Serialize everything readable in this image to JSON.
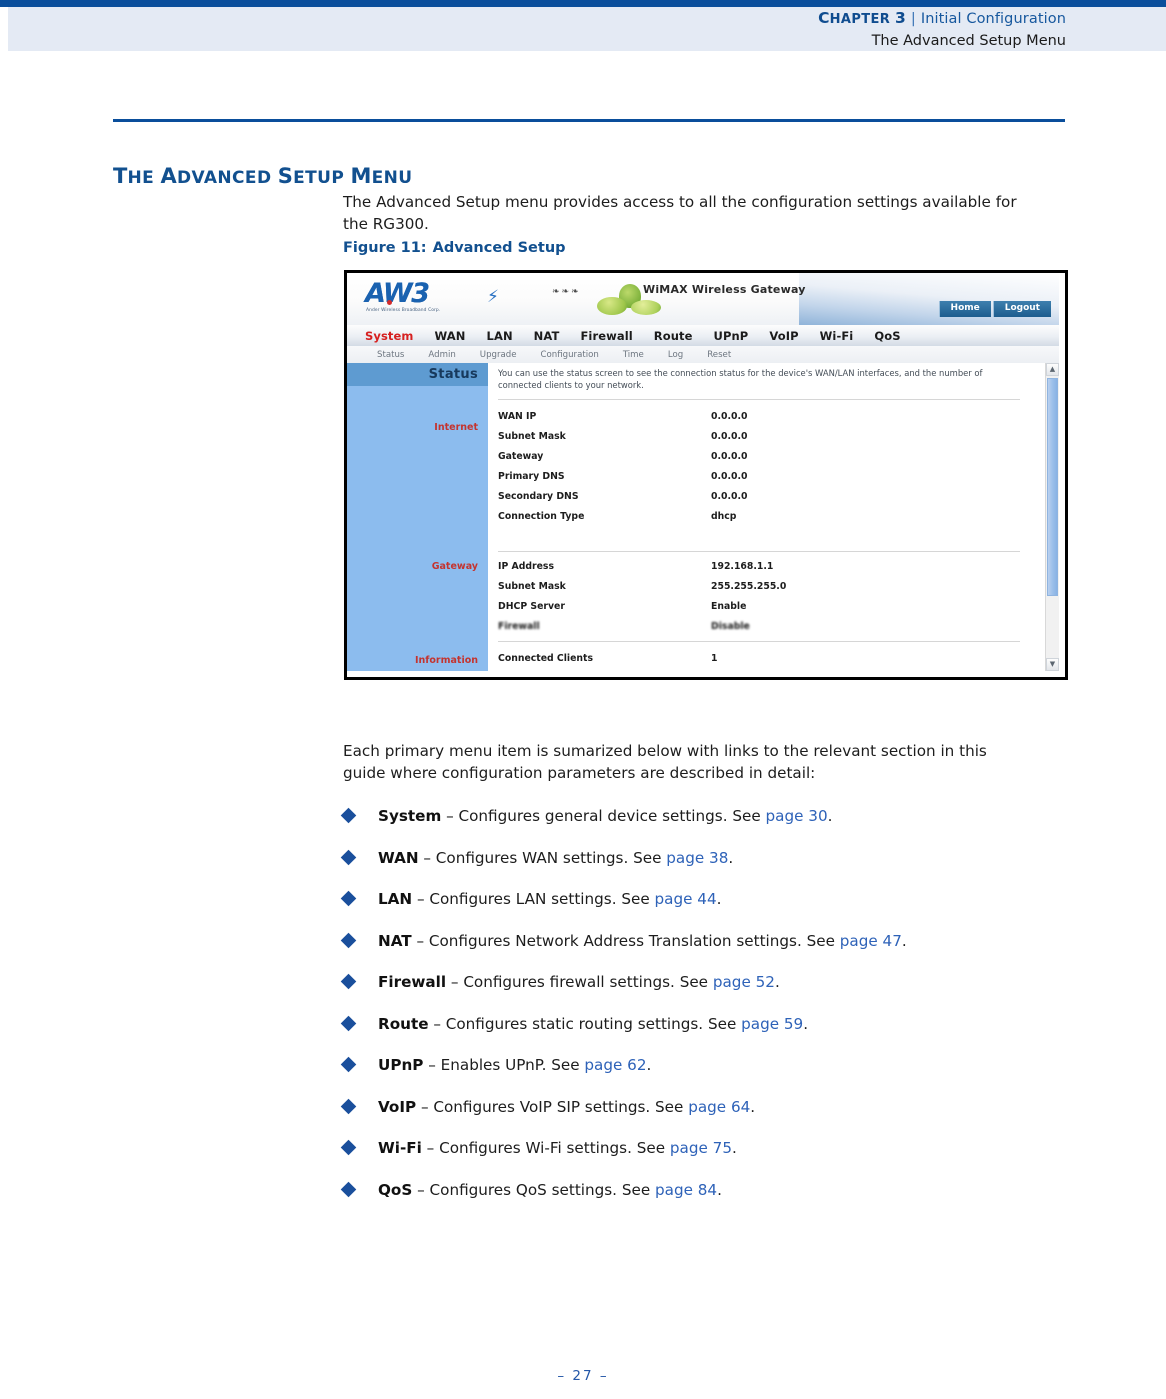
{
  "running_header": {
    "chapter_label_c": "C",
    "chapter_label_rest": "HAPTER",
    "chapter_number": "3",
    "separator": "|",
    "topic": "Initial Configuration",
    "subtitle": "The Advanced Setup Menu"
  },
  "section": {
    "title_parts": [
      {
        "text": "T",
        "size": "big"
      },
      {
        "text": "HE ",
        "size": "small"
      },
      {
        "text": "A",
        "size": "big"
      },
      {
        "text": "DVANCED ",
        "size": "small"
      },
      {
        "text": "S",
        "size": "big"
      },
      {
        "text": "ETUP ",
        "size": "small"
      },
      {
        "text": "M",
        "size": "big"
      },
      {
        "text": "ENU",
        "size": "small"
      }
    ],
    "intro": "The Advanced Setup menu provides access to all the configuration settings available for the RG300."
  },
  "figure": {
    "caption_label": "Figure 11:",
    "caption_title": "Advanced Setup"
  },
  "router_ui": {
    "logo_mark": "AW3",
    "logo_subtitle": "Ander Wireless Broadband Corp.",
    "product_title": "WiMAX Wireless Gateway",
    "actions": [
      "Home",
      "Logout"
    ],
    "nav": [
      {
        "label": "System",
        "active": true
      },
      {
        "label": "WAN",
        "active": false
      },
      {
        "label": "LAN",
        "active": false
      },
      {
        "label": "NAT",
        "active": false
      },
      {
        "label": "Firewall",
        "active": false
      },
      {
        "label": "Route",
        "active": false
      },
      {
        "label": "UPnP",
        "active": false
      },
      {
        "label": "VoIP",
        "active": false
      },
      {
        "label": "Wi-Fi",
        "active": false
      },
      {
        "label": "QoS",
        "active": false
      }
    ],
    "subnav": [
      "Status",
      "Admin",
      "Upgrade",
      "Configuration",
      "Time",
      "Log",
      "Reset"
    ],
    "sidebar": {
      "heading": "Status",
      "group_internet": "Internet",
      "group_gateway": "Gateway",
      "group_information": "Information"
    },
    "description": "You can use the status screen to see the connection status for the device's WAN/LAN interfaces, and the number of connected clients to your network.",
    "internet_rows": [
      {
        "key": "WAN IP",
        "value": "0.0.0.0"
      },
      {
        "key": "Subnet Mask",
        "value": "0.0.0.0"
      },
      {
        "key": "Gateway",
        "value": "0.0.0.0"
      },
      {
        "key": "Primary DNS",
        "value": "0.0.0.0"
      },
      {
        "key": "Secondary DNS",
        "value": "0.0.0.0"
      },
      {
        "key": "Connection Type",
        "value": "dhcp"
      }
    ],
    "gateway_rows": [
      {
        "key": "IP Address",
        "value": "192.168.1.1"
      },
      {
        "key": "Subnet Mask",
        "value": "255.255.255.0"
      },
      {
        "key": "DHCP Server",
        "value": "Enable"
      },
      {
        "key": "Firewall",
        "value": "Disable"
      }
    ],
    "information_rows": [
      {
        "key": "Connected Clients",
        "value": "1"
      }
    ],
    "scroll_up_icon": "scroll-up-arrow",
    "scroll_down_icon": "scroll-down-arrow"
  },
  "after_paragraph": "Each primary menu item is sumarized below with links to the relevant section in this guide where configuration parameters are described in detail:",
  "bullets": [
    {
      "term": "System",
      "dash": " – ",
      "text": "Configures general device settings. See ",
      "link": "page 30",
      "period": "."
    },
    {
      "term": "WAN",
      "dash": " – ",
      "text": "Configures WAN settings. See ",
      "link": "page 38",
      "period": "."
    },
    {
      "term": "LAN",
      "dash": " – ",
      "text": "Configures LAN settings. See ",
      "link": "page 44",
      "period": "."
    },
    {
      "term": "NAT",
      "dash": " – ",
      "text": "Configures Network Address Translation settings. See ",
      "link": "page 47",
      "period": "."
    },
    {
      "term": "Firewall",
      "dash": " – ",
      "text": "Configures firewall settings. See ",
      "link": "page 52",
      "period": "."
    },
    {
      "term": "Route",
      "dash": " – ",
      "text": "Configures static routing settings. See ",
      "link": "page 59",
      "period": "."
    },
    {
      "term": "UPnP",
      "dash": " – ",
      "text": "Enables UPnP. See ",
      "link": "page 62",
      "period": "."
    },
    {
      "term": "VoIP",
      "dash": " – ",
      "text": "Configures VoIP SIP settings. See ",
      "link": "page 64",
      "period": "."
    },
    {
      "term": "Wi-Fi",
      "dash": " – ",
      "text": "Configures Wi-Fi settings. See ",
      "link": "page 75",
      "period": "."
    },
    {
      "term": "QoS",
      "dash": " – ",
      "text": "Configures QoS settings. See ",
      "link": "page 84",
      "period": "."
    }
  ],
  "footer": {
    "page_marker": "–  27  –"
  },
  "colors": {
    "rule_blue": "#0a4e9b",
    "heading_blue": "#12508f",
    "link_blue": "#2e62b8",
    "header_band": "#e4eaf4",
    "bullet_blue": "#1a4f9c",
    "ui_sidebar": "#8cbcee",
    "ui_sidebar_head": "#5e9bd1",
    "ui_label_red": "#c4342f"
  }
}
